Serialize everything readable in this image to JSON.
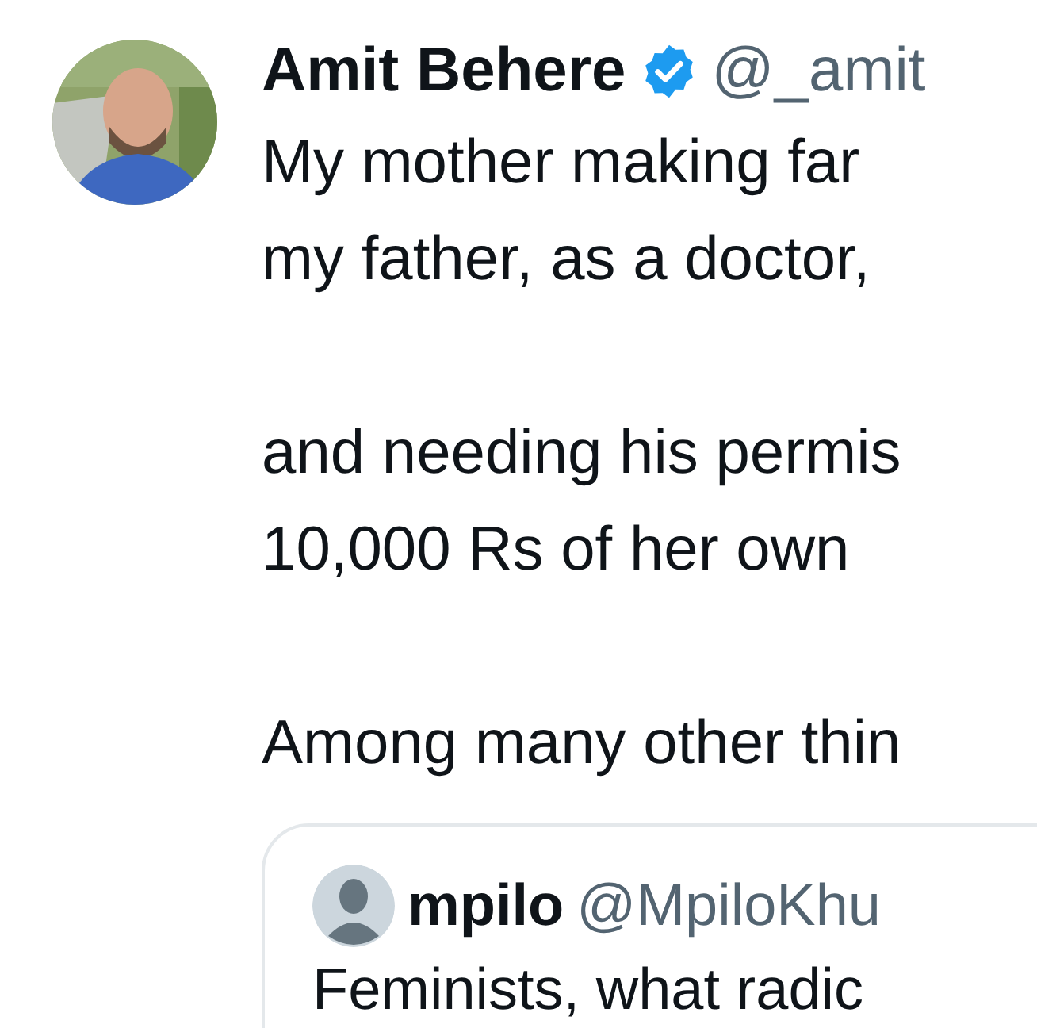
{
  "tweet": {
    "author": {
      "name": "Amit Behere",
      "verified": true,
      "handle": "@_amit"
    },
    "avatar": {
      "kind": "picture"
    },
    "paragraphs": [
      [
        "My mother making far",
        "my father, as a doctor,"
      ],
      [
        "and needing his permis",
        "10,000 Rs of her own"
      ],
      [
        "Among many other thin"
      ]
    ],
    "quoted": {
      "author": {
        "name": "mpilo",
        "handle": "@MpiloKhu"
      },
      "text": "Feminists, what radic"
    }
  }
}
